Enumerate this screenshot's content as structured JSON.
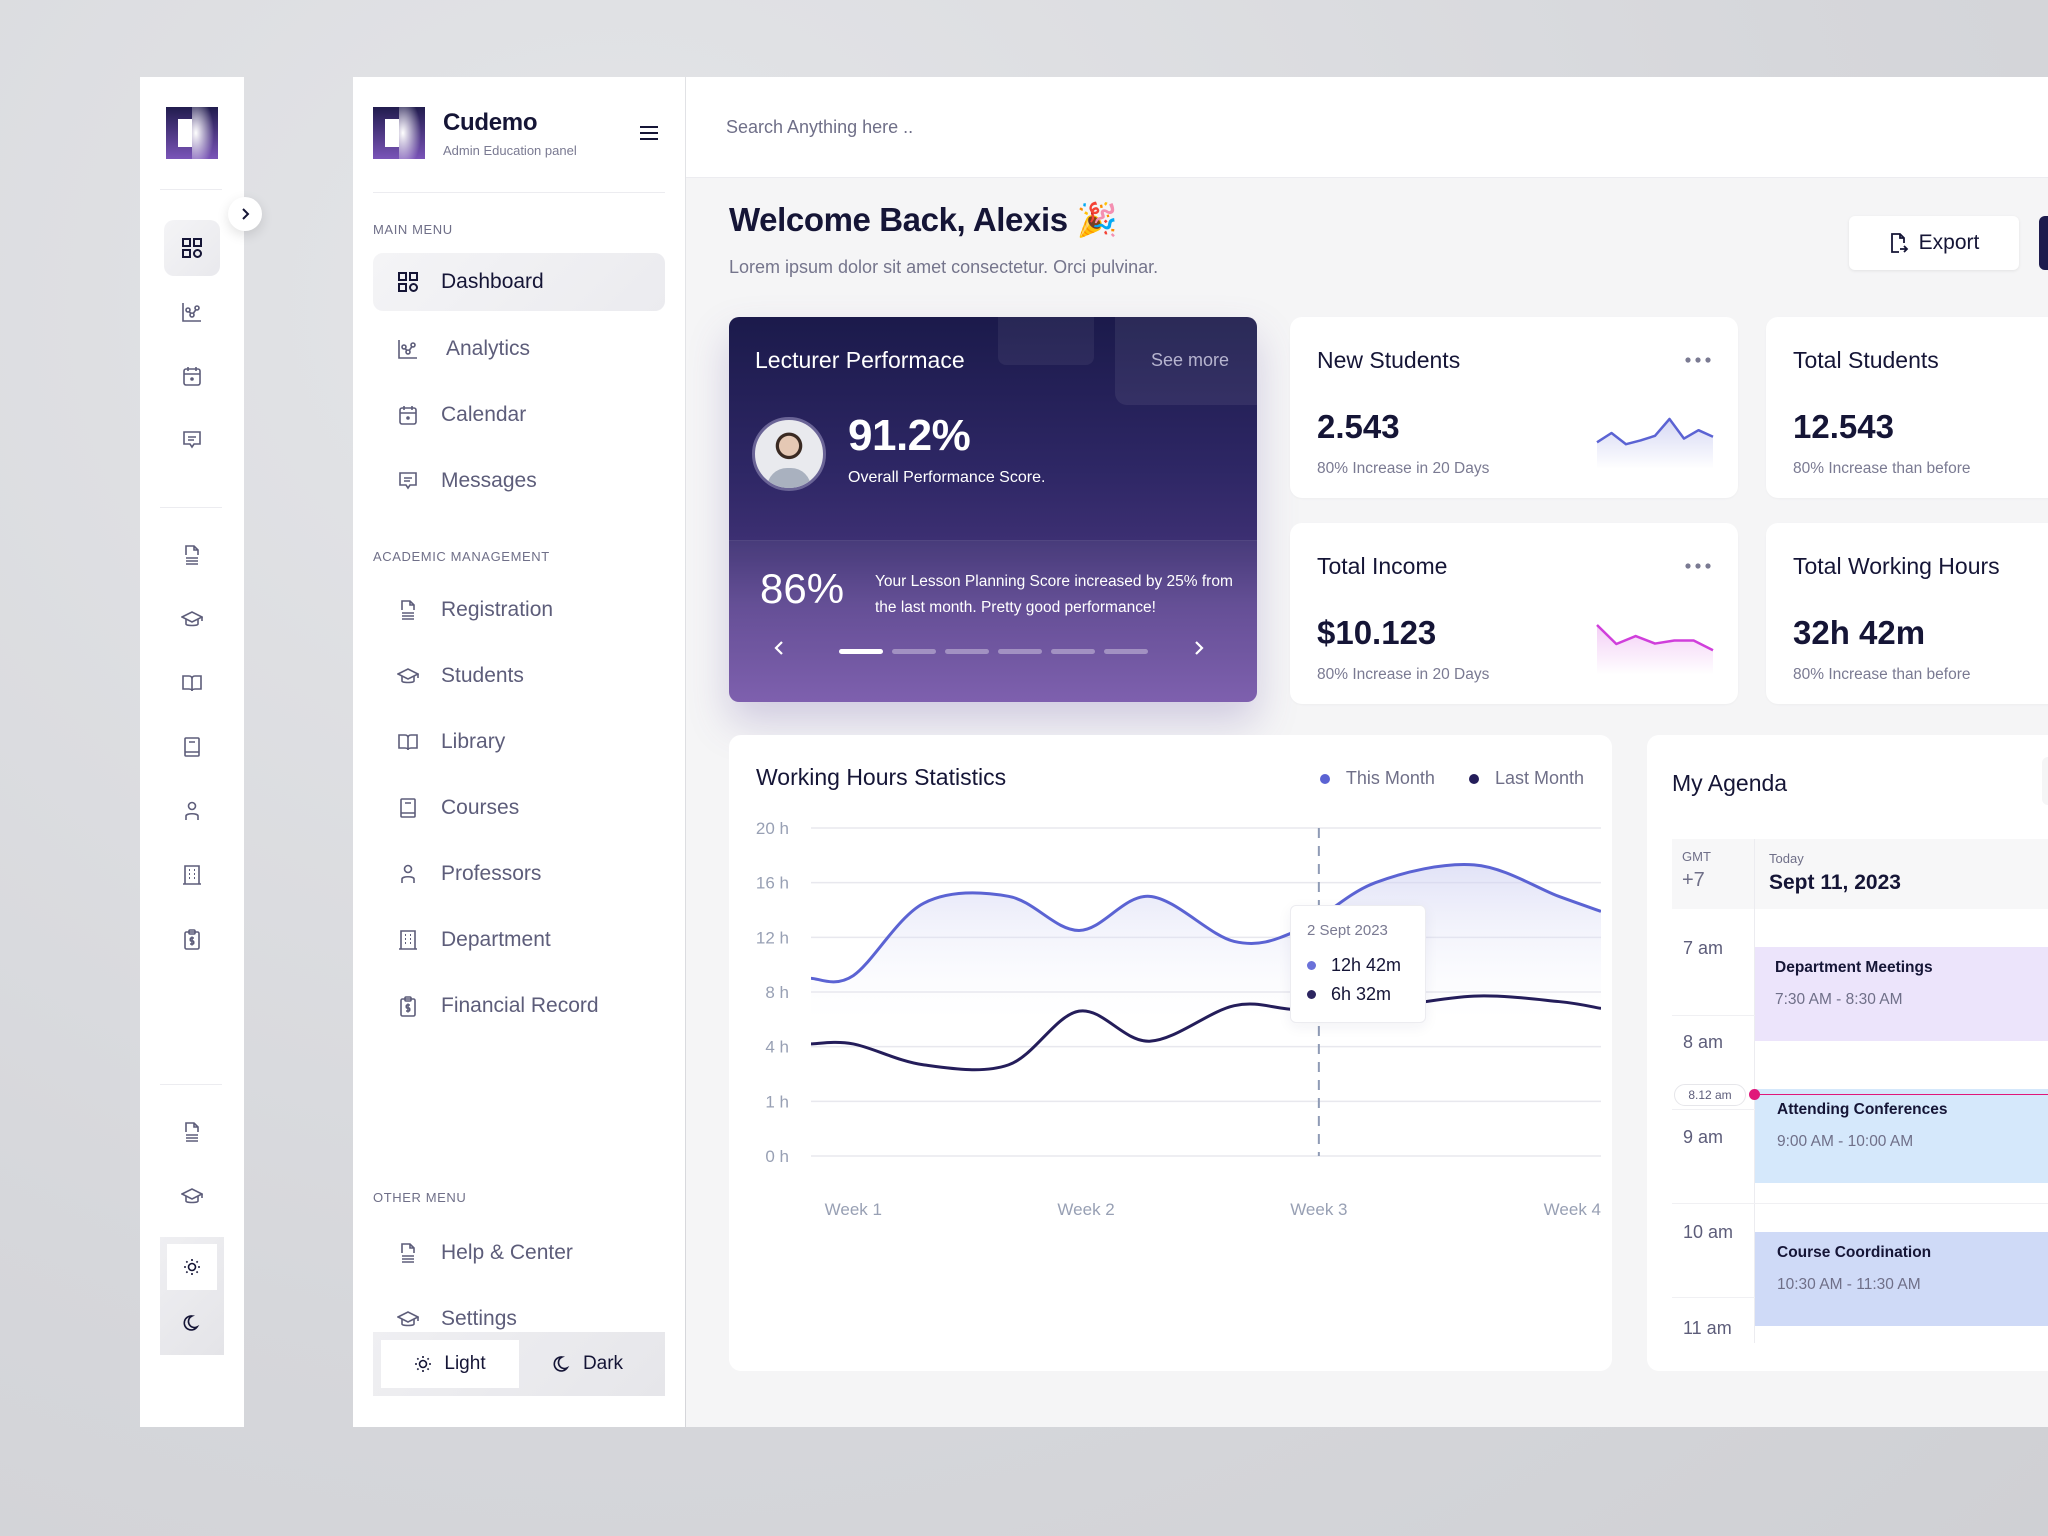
{
  "rail": {
    "expand_icon": "chevron-right-icon",
    "icons": [
      "dashboard-icon",
      "analytics-icon",
      "calendar-icon",
      "messages-icon",
      "registration-icon",
      "students-icon",
      "library-icon",
      "courses-icon",
      "professors-icon",
      "department-icon",
      "financial-record-icon",
      "help-icon",
      "settings-icon"
    ],
    "theme": [
      "sun-icon",
      "moon-icon"
    ]
  },
  "brand": {
    "name": "Cudemo",
    "subtitle": "Admin Education panel"
  },
  "sidebar": {
    "main_menu_label": "MAIN MENU",
    "main_menu": [
      {
        "label": "Dashboard",
        "icon": "dashboard-icon",
        "active": true
      },
      {
        "label": "Analytics",
        "icon": "analytics-icon"
      },
      {
        "label": "Calendar",
        "icon": "calendar-icon"
      },
      {
        "label": "Messages",
        "icon": "messages-icon"
      }
    ],
    "academic_label": "ACADEMIC MANAGEMENT",
    "academic": [
      {
        "label": "Registration",
        "icon": "registration-icon"
      },
      {
        "label": "Students",
        "icon": "students-icon"
      },
      {
        "label": "Library",
        "icon": "library-icon"
      },
      {
        "label": "Courses",
        "icon": "courses-icon"
      },
      {
        "label": "Professors",
        "icon": "professors-icon"
      },
      {
        "label": "Department",
        "icon": "department-icon"
      },
      {
        "label": "Financial Record",
        "icon": "financial-record-icon"
      }
    ],
    "other_label": "OTHER MENU",
    "other": [
      {
        "label": "Help & Center",
        "icon": "help-icon"
      },
      {
        "label": "Settings",
        "icon": "settings-icon"
      }
    ],
    "theme": {
      "light": "Light",
      "dark": "Dark",
      "selected": "Light"
    }
  },
  "header": {
    "search_placeholder": "Search Anything here ..",
    "welcome": "Welcome Back, Alexis 🎉",
    "subtitle": "Lorem ipsum dolor sit amet consectetur. Orci pulvinar.",
    "export_label": "Export"
  },
  "performance": {
    "title": "Lecturer Performace",
    "see_more": "See more",
    "score": "91.2%",
    "score_label": "Overall Performance Score.",
    "lesson_score": "86%",
    "lesson_desc": "Your Lesson Planning Score increased by 25% from the last month. Pretty good performance!",
    "slides_total": 6,
    "slide_active": 1
  },
  "stats": [
    {
      "title": "New Students",
      "value": "2.543",
      "sub": "80% Increase in 20 Days",
      "spark": [
        4,
        6,
        3.6,
        4.4,
        5.4,
        9,
        4.8,
        6.6,
        5.2
      ],
      "color": "#5b63d3"
    },
    {
      "title": "Total Students",
      "value": "12.543",
      "sub": "80% Increase than before"
    },
    {
      "title": "Total Income",
      "value": "$10.123",
      "sub": "80% Increase in 20 Days",
      "spark": [
        9.5,
        5.2,
        7,
        5.3,
        6,
        6,
        3.8
      ],
      "color": "#d03fdb"
    },
    {
      "title": "Total Working Hours",
      "value": "32h 42m",
      "sub": "80% Increase than before"
    }
  ],
  "chart_data": {
    "type": "line",
    "title": "Working Hours Statistics",
    "xlabel": "",
    "ylabel": "",
    "categories": [
      "Week 1",
      "Week 2",
      "Week 3",
      "Week 4"
    ],
    "y_ticks": [
      "0 h",
      "1 h",
      "4 h",
      "8 h",
      "12 h",
      "16 h",
      "20 h"
    ],
    "y_tick_values": [
      0,
      1,
      4,
      8,
      12,
      16,
      20
    ],
    "ylim": [
      0,
      20
    ],
    "x": [
      0,
      0.3,
      0.8,
      1.4,
      1.9,
      2.4,
      3.0,
      3.45,
      4.0,
      4.7,
      5.3,
      5.6
    ],
    "series": [
      {
        "name": "This Month",
        "color": "#5b63d3",
        "values": [
          9,
          9.2,
          14.5,
          15,
          12.5,
          15,
          11.7,
          12.5,
          16,
          17.3,
          15,
          13.9
        ]
      },
      {
        "name": "Last Month",
        "color": "#241d5a",
        "values": [
          4.2,
          4.2,
          3,
          3,
          6.6,
          4.4,
          7,
          6.7,
          6.8,
          7.7,
          7.3,
          6.8
        ]
      }
    ],
    "x_tick_positions": [
      0.3,
      1.95,
      3.6,
      5.2
    ],
    "x_max": 5.6,
    "highlight": {
      "x": 3.6,
      "date": "2 Sept 2023",
      "this_month": "12h 42m",
      "last_month": "6h 32m"
    },
    "grid": true,
    "legend": "top-right"
  },
  "agenda": {
    "title": "My Agenda",
    "gmt_label": "GMT",
    "gmt_value": "+7",
    "today_label": "Today",
    "date": "Sept 11, 2023",
    "hours": [
      "7 am",
      "8 am",
      "9 am",
      "10 am",
      "11 am"
    ],
    "now": "8.12 am",
    "events": [
      {
        "title": "Department Meetings",
        "time": "7:30 AM - 8:30 AM",
        "color": "#ece4fb"
      },
      {
        "title": "Attending Conferences",
        "time": "9:00 AM - 10:00 AM",
        "color": "#d5e8fb"
      },
      {
        "title": "Course Coordination",
        "time": "10:30 AM - 11:30 AM",
        "color": "#cfdaf7"
      }
    ]
  }
}
